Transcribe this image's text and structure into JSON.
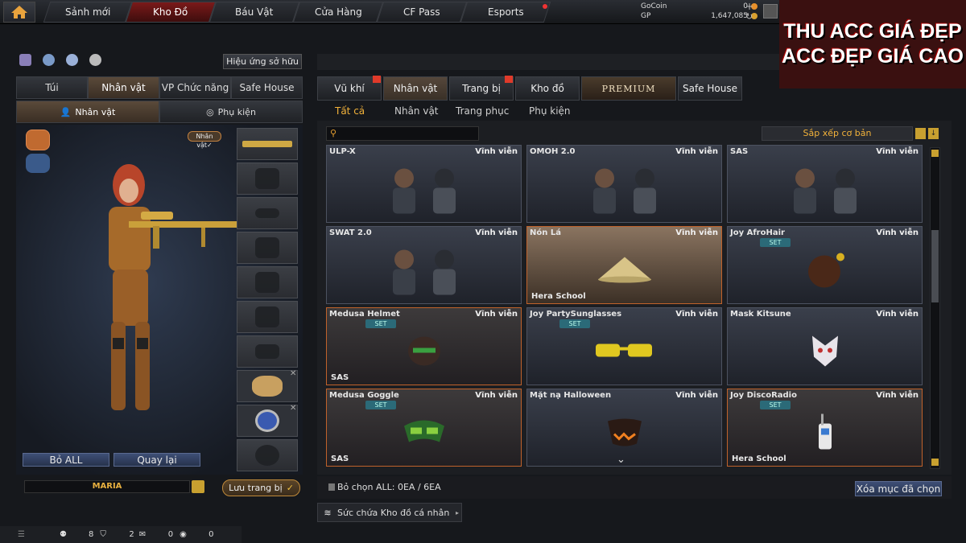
{
  "nav": {
    "tabs": [
      "Sảnh mới",
      "Kho Đồ",
      "Báu Vật",
      "Cửa Hàng",
      "CF Pass",
      "Esports"
    ],
    "active_tab": "Kho Đồ"
  },
  "currency": {
    "gocoin_label": "GoCoin",
    "gocoin_value": "0",
    "gp_label": "GP",
    "gp_value": "1,647,085"
  },
  "watermark": {
    "line1": "THU ACC GIÁ ĐẸP",
    "line2": "ACC ĐẸP GIÁ CAO"
  },
  "left": {
    "effect_button": "Hiệu ứng sở hữu",
    "tabs": [
      "Túi",
      "Nhân vật",
      "VP Chức năng",
      "Safe House"
    ],
    "active_tab": "Nhân vật",
    "subtabs": [
      "Nhân vật",
      "Phụ kiện"
    ],
    "character_badge": "Nhân vật✓",
    "remove_all": "Bỏ ALL",
    "back": "Quay lại",
    "character_name": "MARIA",
    "save_button": "Lưu trang bị"
  },
  "right": {
    "tabs": [
      "Vũ khí",
      "Nhân vật",
      "Trang bị",
      "Kho đồ",
      "PREMIUM",
      "Safe House"
    ],
    "active_tab": "Nhân vật",
    "subtabs": [
      "Tất cả",
      "Nhân vật",
      "Trang phục",
      "Phụ kiện"
    ],
    "active_subtab": "Tất cả",
    "search_placeholder": "",
    "sort_label": "Sắp xếp cơ bản",
    "selection_text": "Bỏ chọn ALL: 0EA / 6EA",
    "delete_selected": "Xóa mục đã chọn",
    "capacity": "Sức chứa Kho đồ cá nhân"
  },
  "items": [
    {
      "name": "ULP-X",
      "duration": "Vĩnh viễn",
      "set": "",
      "tag": "",
      "style": "normal",
      "art": "chars"
    },
    {
      "name": "OMOH 2.0",
      "duration": "Vĩnh viễn",
      "set": "",
      "tag": "",
      "style": "normal",
      "art": "chars"
    },
    {
      "name": "SAS",
      "duration": "Vĩnh viễn",
      "set": "",
      "tag": "",
      "style": "normal",
      "art": "chars"
    },
    {
      "name": "SWAT 2.0",
      "duration": "Vĩnh viễn",
      "set": "",
      "tag": "",
      "style": "normal",
      "art": "chars"
    },
    {
      "name": "Nón Lá",
      "duration": "Vĩnh viễn",
      "set": "",
      "tag": "Hera School",
      "style": "beige",
      "art": "hat"
    },
    {
      "name": "Joy AfroHair",
      "duration": "Vĩnh viễn",
      "set": "SET",
      "tag": "",
      "style": "normal",
      "art": "afro"
    },
    {
      "name": "Medusa Helmet",
      "duration": "Vĩnh viễn",
      "set": "SET",
      "tag": "SAS",
      "style": "orange",
      "art": "helmet"
    },
    {
      "name": "Joy PartySunglasses",
      "duration": "Vĩnh viễn",
      "set": "SET",
      "tag": "",
      "style": "normal",
      "art": "glasses"
    },
    {
      "name": "Mask Kitsune",
      "duration": "Vĩnh viễn",
      "set": "",
      "tag": "",
      "style": "normal",
      "art": "kitsune"
    },
    {
      "name": "Medusa Goggle",
      "duration": "Vĩnh viễn",
      "set": "SET",
      "tag": "SAS",
      "style": "orange",
      "art": "goggle"
    },
    {
      "name": "Mặt nạ Halloween",
      "duration": "Vĩnh viễn",
      "set": "",
      "tag": "",
      "style": "normal",
      "art": "halloween"
    },
    {
      "name": "Joy DiscoRadio",
      "duration": "Vĩnh viễn",
      "set": "SET",
      "tag": "Hera School",
      "style": "orange",
      "art": "radio"
    }
  ],
  "footer": {
    "count1": "8",
    "count2": "2",
    "count3": "0",
    "count4": "0"
  },
  "colors": {
    "accent_orange": "#f2b23a",
    "active_red": "#7a1a1a",
    "watermark_text": "#ffffff",
    "watermark_bg": "#3a1010"
  }
}
